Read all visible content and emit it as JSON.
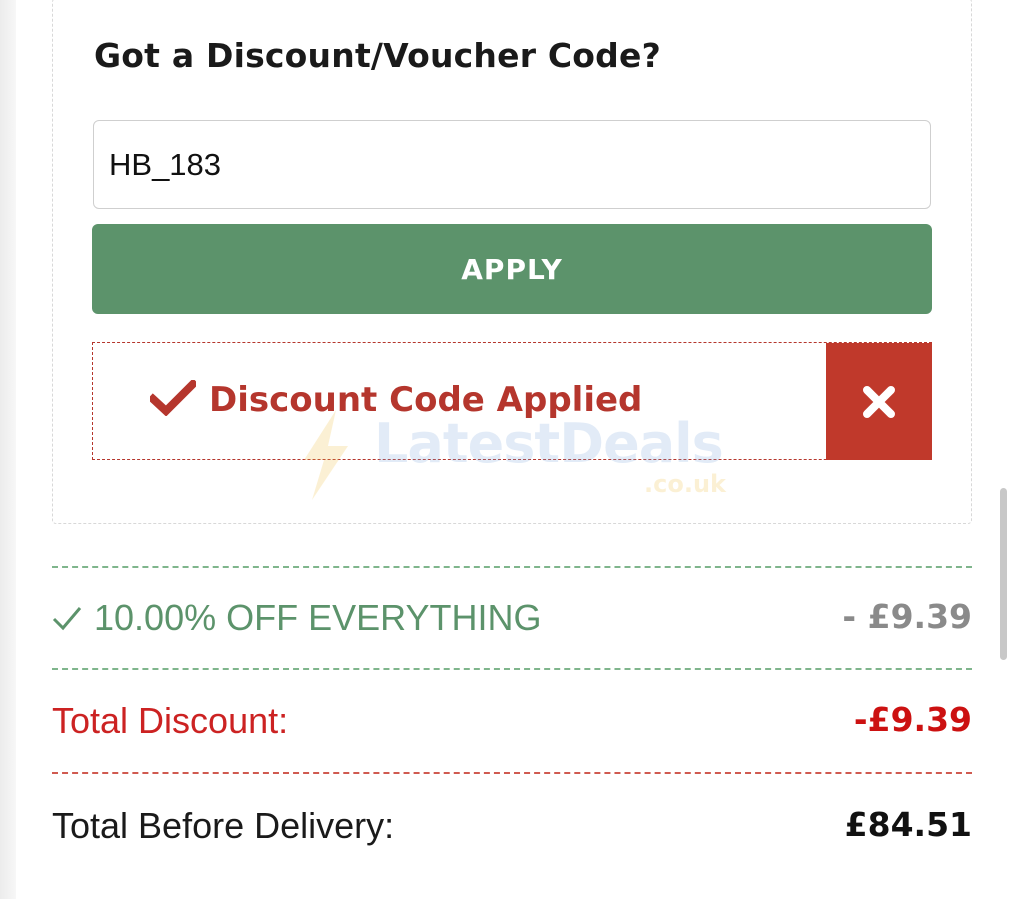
{
  "voucher": {
    "title": "Got a Discount/Voucher Code?",
    "code_value": "HB_183",
    "apply_label": "APPLY",
    "applied_message": "Discount Code Applied"
  },
  "watermark": {
    "brand": "LatestDeals",
    "domain": ".co.uk"
  },
  "summary": {
    "offer_label": "10.00% OFF EVERYTHING",
    "offer_amount": "- £9.39",
    "total_discount_label": "Total Discount:",
    "total_discount_amount": "-£9.39",
    "total_before_delivery_label": "Total Before Delivery:",
    "total_before_delivery_amount": "£84.51"
  },
  "icons": {
    "applied": "check-icon",
    "remove": "close-icon",
    "offer": "checkmark-icon"
  },
  "colors": {
    "apply_button": "#5c936b",
    "applied_text": "#b5362d",
    "remove_button": "#c0392b",
    "offer_text": "#5c936b",
    "discount_text": "#cc2222"
  }
}
